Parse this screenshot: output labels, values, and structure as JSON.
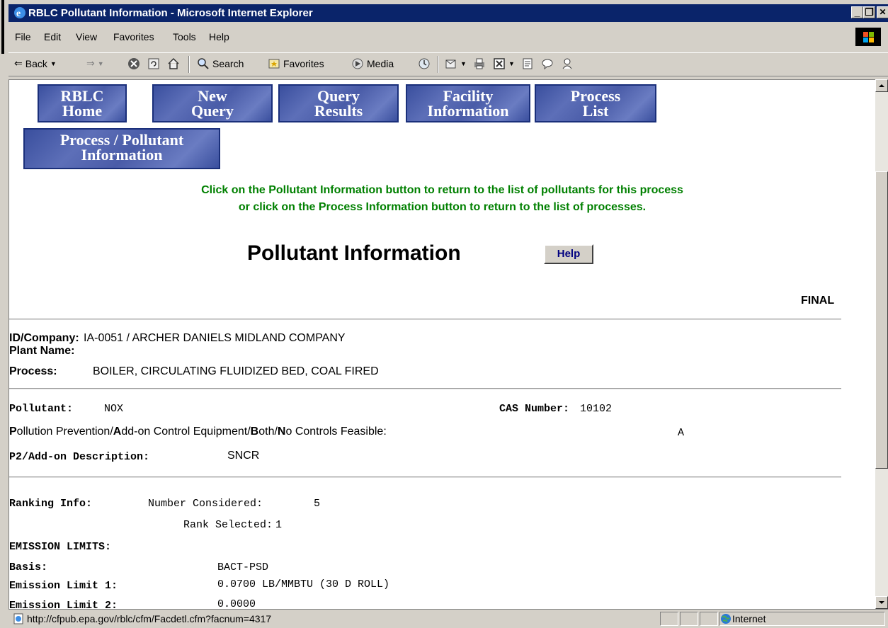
{
  "window": {
    "title": "RBLC Pollutant Information - Microsoft Internet Explorer",
    "minimize": "_",
    "maximize": "❐",
    "close": "✕"
  },
  "menu": [
    "File",
    "Edit",
    "View",
    "Favorites",
    "Tools",
    "Help"
  ],
  "toolbar": {
    "back": "Back",
    "search": "Search",
    "favorites": "Favorites",
    "media": "Media"
  },
  "nav": {
    "rblc_home": [
      "RBLC",
      "Home"
    ],
    "new_query": [
      "New",
      "Query"
    ],
    "query_results": [
      "Query",
      "Results"
    ],
    "facility_information": [
      "Facility",
      "Information"
    ],
    "process_list": [
      "Process",
      "List"
    ],
    "process_pollutant": [
      "Process / Pollutant",
      "Information"
    ]
  },
  "instructions": {
    "line1": "Click on the Pollutant Information button to return to the list of pollutants for this process",
    "line2": "or click on the Process Information button to return to the list of processes."
  },
  "heading": "Pollutant Information",
  "help_label": "Help",
  "status_final": "FINAL",
  "facility": {
    "id_company_label": "ID/Company:",
    "id_company_value": "IA-0051 / ARCHER DANIELS MIDLAND COMPANY",
    "plant_name_label": "Plant Name:",
    "plant_name_value": "",
    "process_label": "Process:",
    "process_value": "BOILER, CIRCULATING FLUIDIZED BED, COAL FIRED"
  },
  "pollutant": {
    "pollutant_label": "Pollutant:",
    "pollutant_value": "NOX",
    "cas_label": "CAS Number:",
    "cas_value": "10102",
    "ppae_label_parts": [
      "P",
      "ollution Prevention/",
      "A",
      "dd-on Control Equipment/",
      "B",
      "oth/",
      "N",
      "o Controls Feasible:"
    ],
    "ppae_value": "A",
    "p2_label": "P2/Add-on Description:",
    "p2_value": "SNCR"
  },
  "ranking": {
    "label": "Ranking Info:",
    "considered_label": "Number Considered:",
    "considered_value": "5",
    "selected_label": "Rank Selected:",
    "selected_value": "1"
  },
  "emission": {
    "header": "EMISSION LIMITS:",
    "basis_label": "Basis:",
    "basis_value": "BACT-PSD",
    "limit1_label": "Emission Limit 1:",
    "limit1_value": "0.0700 LB/MMBTU (30 D ROLL)",
    "limit2_label": "Emission Limit 2:",
    "limit2_value": "0.0000"
  },
  "statusbar": {
    "url": "http://cfpub.epa.gov/rblc/cfm/Facdetl.cfm?facnum=4317",
    "zone": "Internet"
  }
}
